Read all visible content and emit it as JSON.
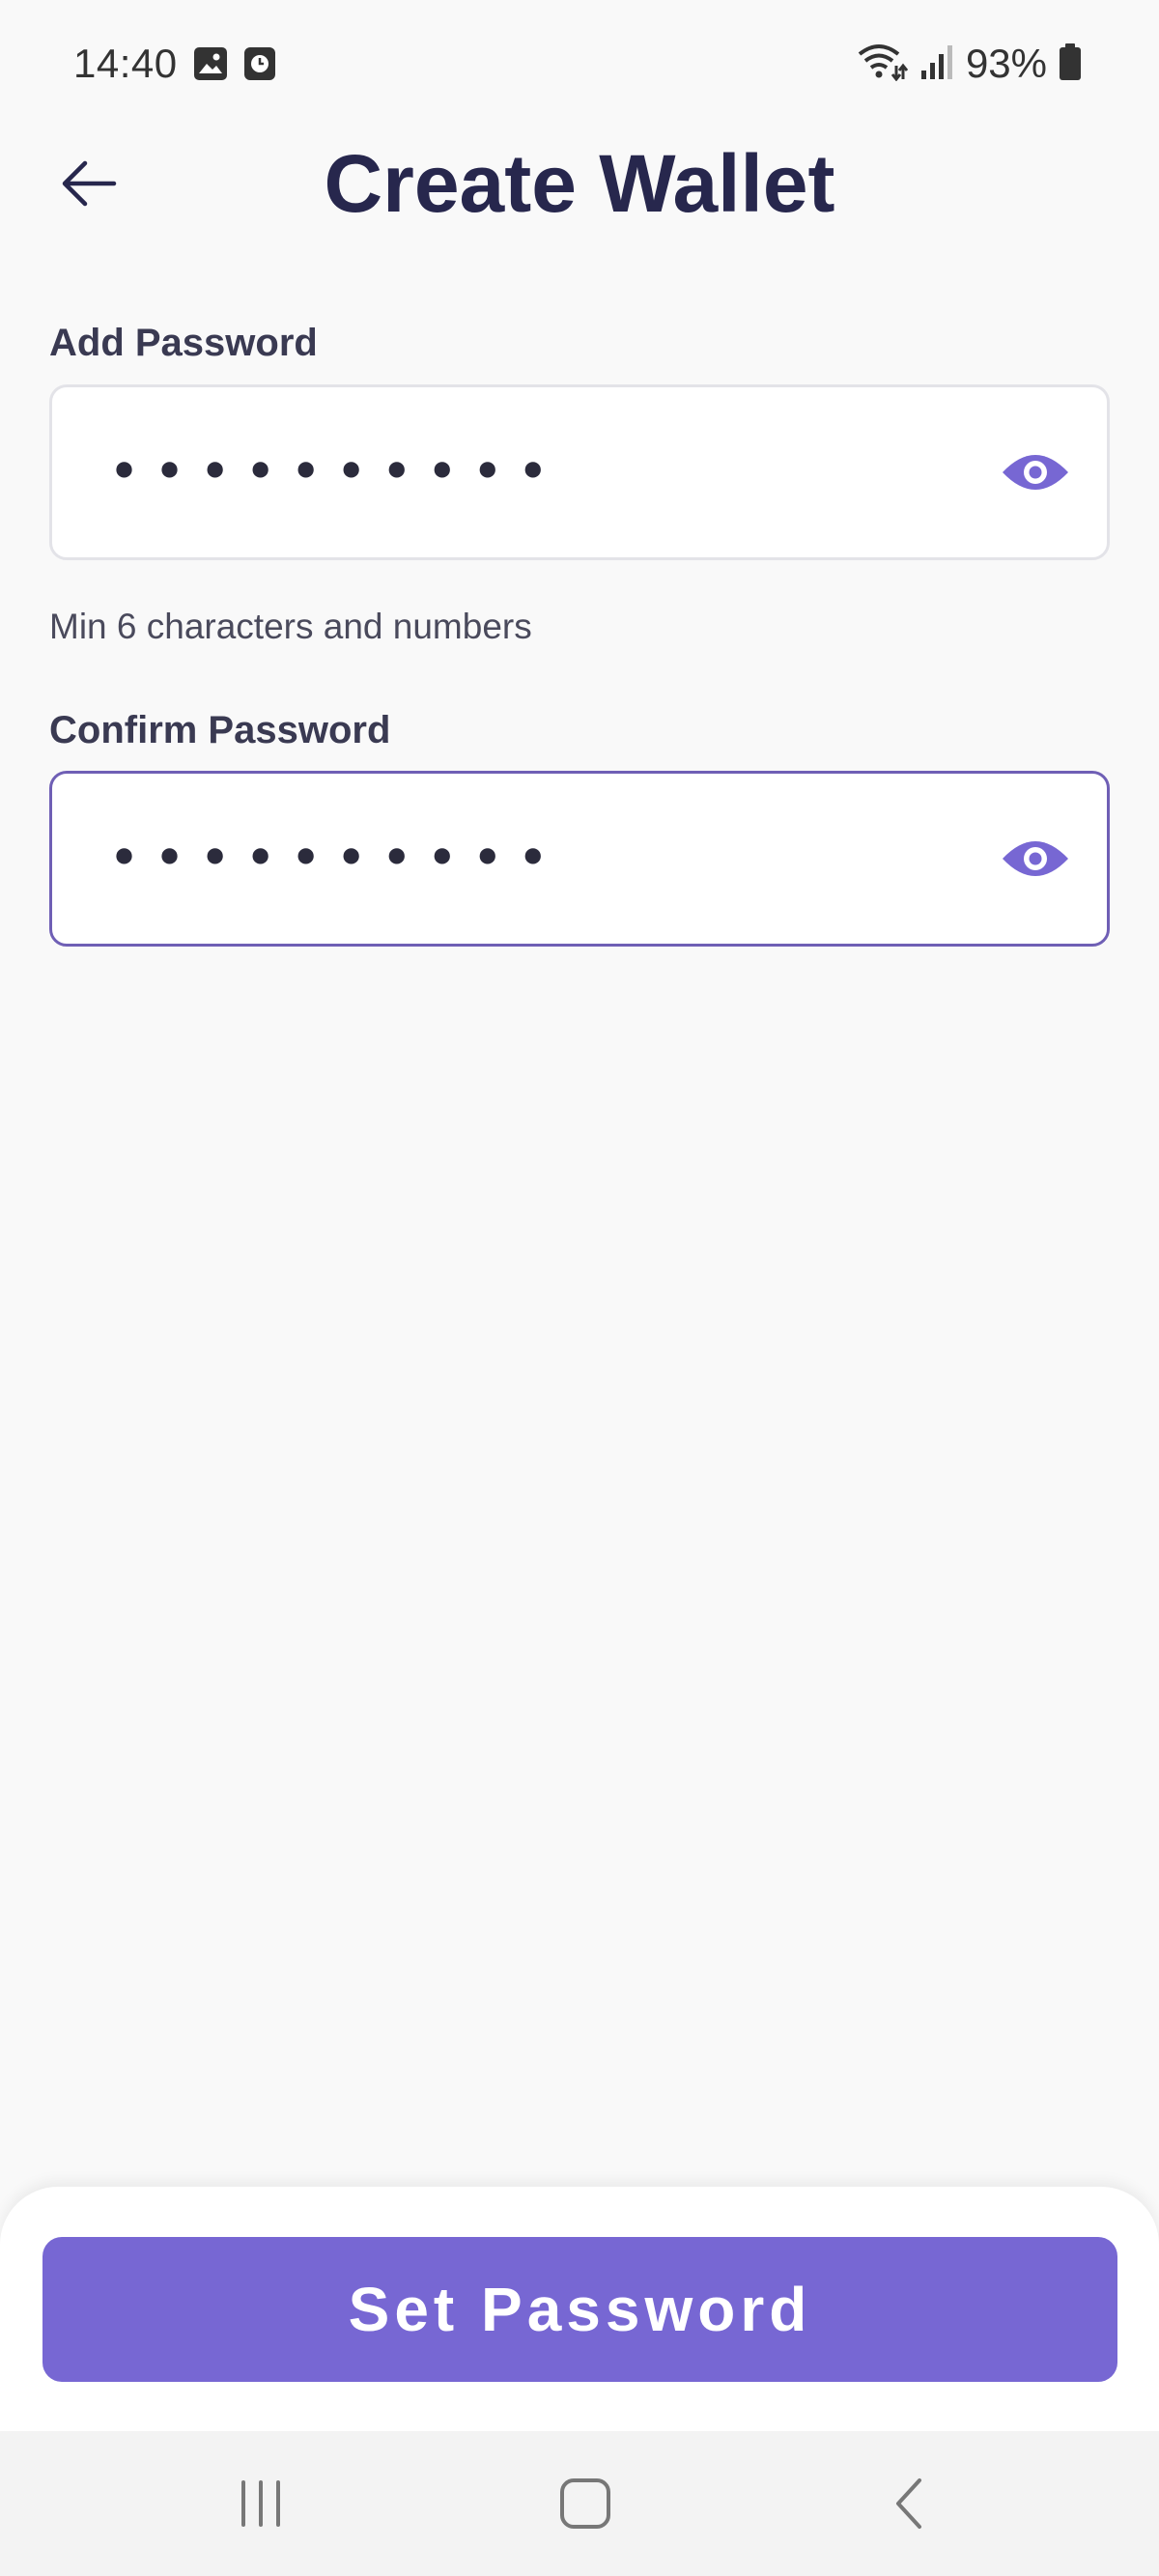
{
  "status_bar": {
    "time": "14:40",
    "left_icons": [
      "image-icon",
      "clock-app-icon"
    ],
    "right_icons": [
      "wifi-icon",
      "signal-icon",
      "battery-icon"
    ],
    "battery": "93%"
  },
  "header": {
    "title": "Create Wallet",
    "back_icon": "arrow-left-icon"
  },
  "form": {
    "password": {
      "label": "Add Password",
      "value": "••••••••••",
      "icon": "eye-icon"
    },
    "helper": "Min 6 characters and numbers",
    "confirm": {
      "label": "Confirm Password",
      "value": "••••••••••",
      "icon": "eye-icon"
    }
  },
  "primary_button": {
    "label": "Set Password"
  },
  "nav_bar": {
    "icons": [
      "recent-apps-icon",
      "home-icon",
      "back-icon"
    ]
  },
  "colors": {
    "accent": "#7767d3",
    "focused_border": "#6f5fb5",
    "title": "#27274d",
    "background": "#f9f9f9"
  }
}
